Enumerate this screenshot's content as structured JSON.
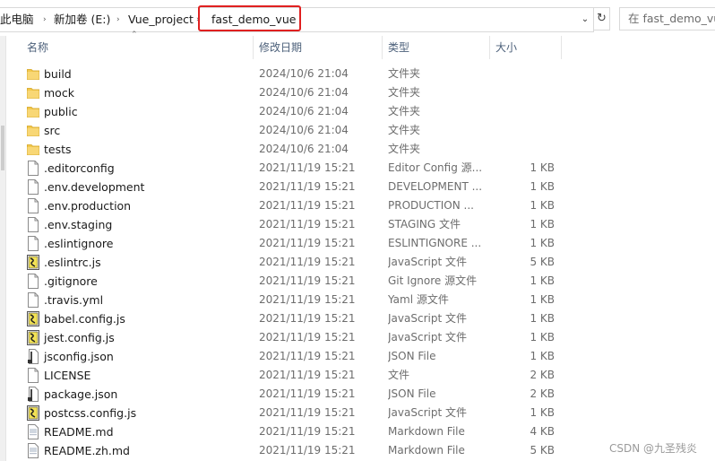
{
  "breadcrumb": {
    "items": [
      "此电脑",
      "新加卷 (E:)",
      "Vue_project",
      "fast_demo_vue"
    ],
    "separator": "›"
  },
  "search": {
    "placeholder": "在 fast_demo_vue 中搜索"
  },
  "columns": {
    "name": "名称",
    "date": "修改日期",
    "type": "类型",
    "size": "大小"
  },
  "files": [
    {
      "name": "build",
      "date": "2024/10/6 21:04",
      "type": "文件夹",
      "size": "",
      "icon": "folder"
    },
    {
      "name": "mock",
      "date": "2024/10/6 21:04",
      "type": "文件夹",
      "size": "",
      "icon": "folder"
    },
    {
      "name": "public",
      "date": "2024/10/6 21:04",
      "type": "文件夹",
      "size": "",
      "icon": "folder"
    },
    {
      "name": "src",
      "date": "2024/10/6 21:04",
      "type": "文件夹",
      "size": "",
      "icon": "folder"
    },
    {
      "name": "tests",
      "date": "2024/10/6 21:04",
      "type": "文件夹",
      "size": "",
      "icon": "folder"
    },
    {
      "name": ".editorconfig",
      "date": "2021/11/19 15:21",
      "type": "Editor Config 源...",
      "size": "1 KB",
      "icon": "file"
    },
    {
      "name": ".env.development",
      "date": "2021/11/19 15:21",
      "type": "DEVELOPMENT ...",
      "size": "1 KB",
      "icon": "file"
    },
    {
      "name": ".env.production",
      "date": "2021/11/19 15:21",
      "type": "PRODUCTION ...",
      "size": "1 KB",
      "icon": "file"
    },
    {
      "name": ".env.staging",
      "date": "2021/11/19 15:21",
      "type": "STAGING 文件",
      "size": "1 KB",
      "icon": "file"
    },
    {
      "name": ".eslintignore",
      "date": "2021/11/19 15:21",
      "type": "ESLINTIGNORE ...",
      "size": "1 KB",
      "icon": "file"
    },
    {
      "name": ".eslintrc.js",
      "date": "2021/11/19 15:21",
      "type": "JavaScript 文件",
      "size": "5 KB",
      "icon": "js"
    },
    {
      "name": ".gitignore",
      "date": "2021/11/19 15:21",
      "type": "Git Ignore 源文件",
      "size": "1 KB",
      "icon": "file"
    },
    {
      "name": ".travis.yml",
      "date": "2021/11/19 15:21",
      "type": "Yaml 源文件",
      "size": "1 KB",
      "icon": "file"
    },
    {
      "name": "babel.config.js",
      "date": "2021/11/19 15:21",
      "type": "JavaScript 文件",
      "size": "1 KB",
      "icon": "js"
    },
    {
      "name": "jest.config.js",
      "date": "2021/11/19 15:21",
      "type": "JavaScript 文件",
      "size": "1 KB",
      "icon": "js"
    },
    {
      "name": "jsconfig.json",
      "date": "2021/11/19 15:21",
      "type": "JSON File",
      "size": "1 KB",
      "icon": "json"
    },
    {
      "name": "LICENSE",
      "date": "2021/11/19 15:21",
      "type": "文件",
      "size": "2 KB",
      "icon": "file"
    },
    {
      "name": "package.json",
      "date": "2021/11/19 15:21",
      "type": "JSON File",
      "size": "2 KB",
      "icon": "json"
    },
    {
      "name": "postcss.config.js",
      "date": "2021/11/19 15:21",
      "type": "JavaScript 文件",
      "size": "1 KB",
      "icon": "js"
    },
    {
      "name": "README.md",
      "date": "2021/11/19 15:21",
      "type": "Markdown File",
      "size": "4 KB",
      "icon": "md"
    },
    {
      "name": "README.zh.md",
      "date": "2021/11/19 15:21",
      "type": "Markdown File",
      "size": "5 KB",
      "icon": "md"
    }
  ],
  "watermark": "CSDN @九圣残炎",
  "colors": {
    "highlight": "#e02020",
    "folder": "#f3c94d",
    "header_text": "#4c607a"
  }
}
